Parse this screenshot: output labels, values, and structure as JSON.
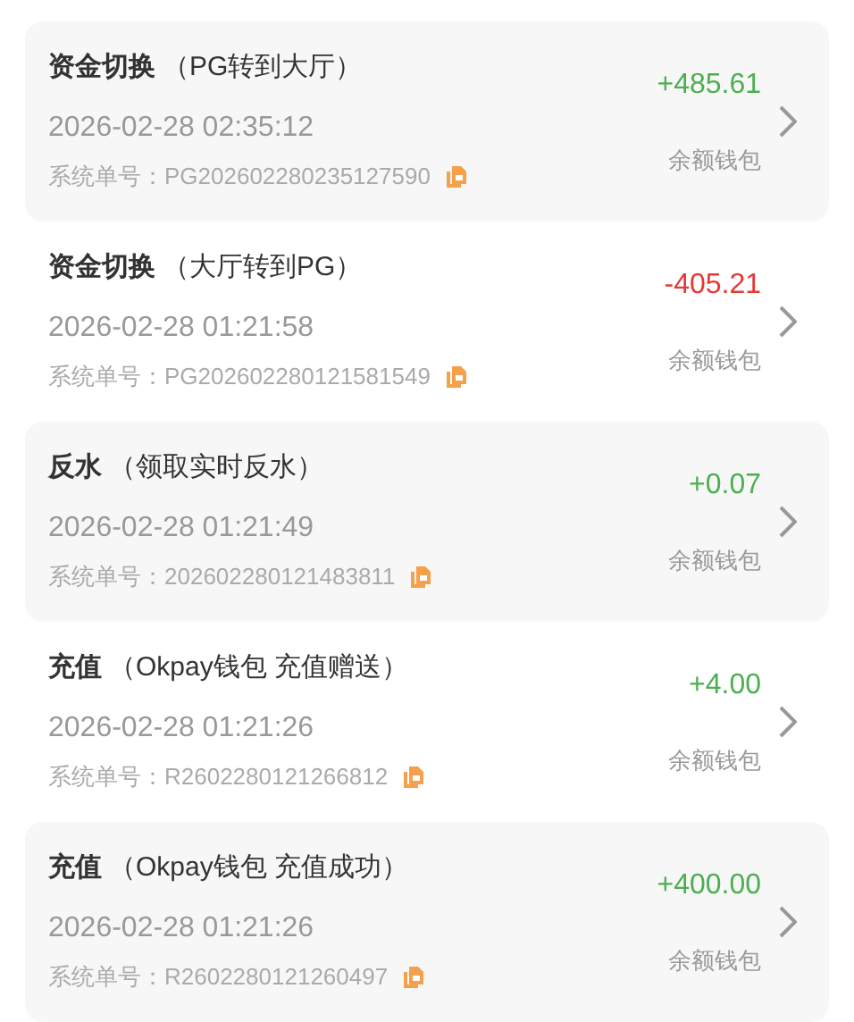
{
  "records": [
    {
      "type": "资金切换",
      "detail": "（PG转到大厅）",
      "time": "2026-02-28 02:35:12",
      "order_label": "系统单号：",
      "order_no": "PG202602280235127590",
      "amount": "+485.61",
      "color": "#4caf50",
      "wallet": "余额钱包"
    },
    {
      "type": "资金切换",
      "detail": "（大厅转到PG）",
      "time": "2026-02-28 01:21:58",
      "order_label": "系统单号：",
      "order_no": "PG202602280121581549",
      "amount": "-405.21",
      "color": "#e53935",
      "wallet": "余额钱包"
    },
    {
      "type": "反水",
      "detail": "（领取实时反水）",
      "time": "2026-02-28 01:21:49",
      "order_label": "系统单号：",
      "order_no": "202602280121483811",
      "amount": "+0.07",
      "color": "#4caf50",
      "wallet": "余额钱包"
    },
    {
      "type": "充值",
      "detail": "（Okpay钱包 充值赠送）",
      "time": "2026-02-28 01:21:26",
      "order_label": "系统单号：",
      "order_no": "R2602280121266812",
      "amount": "+4.00",
      "color": "#4caf50",
      "wallet": "余额钱包"
    },
    {
      "type": "充值",
      "detail": "（Okpay钱包 充值成功）",
      "time": "2026-02-28 01:21:26",
      "order_label": "系统单号：",
      "order_no": "R2602280121260497",
      "amount": "+400.00",
      "color": "#4caf50",
      "wallet": "余额钱包"
    }
  ]
}
